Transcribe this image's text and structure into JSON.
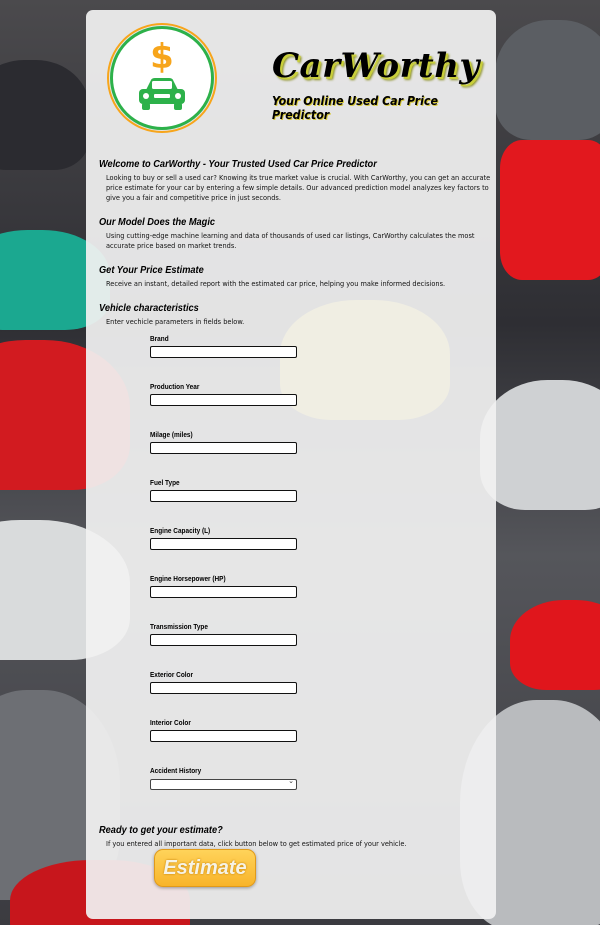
{
  "header": {
    "brand_title": "CarWorthy",
    "brand_subtitle": "Your Online Used Car Price Predictor"
  },
  "sections": {
    "welcome": {
      "heading": "Welcome to CarWorthy - Your Trusted Used Car Price Predictor",
      "text": "Looking to buy or sell a used car? Knowing its true market value is crucial. With CarWorthy, you can get an accurate price estimate for your car by entering a few simple details. Our advanced prediction model analyzes key factors to give you a fair and competitive price in just seconds."
    },
    "model": {
      "heading": "Our Model Does the Magic",
      "text": "Using cutting-edge machine learning and data of thousands of used car listings, CarWorthy calculates the most accurate price based on market trends."
    },
    "estimate": {
      "heading": "Get Your Price Estimate",
      "text": "Receive an instant, detailed report with the estimated car price, helping you make informed decisions."
    },
    "vehicle": {
      "heading": "Vehicle characteristics",
      "text": "Enter vechicle parameters in fields below."
    },
    "ready": {
      "heading": "Ready to get your estimate?",
      "text": "If you entered all important data, click button below to get estimated price of your vehicle."
    }
  },
  "form": {
    "fields": [
      {
        "label": "Brand",
        "value": ""
      },
      {
        "label": "Production Year",
        "value": ""
      },
      {
        "label": "Milage (miles)",
        "value": ""
      },
      {
        "label": "Fuel Type",
        "value": ""
      },
      {
        "label": "Engine Capacity (L)",
        "value": ""
      },
      {
        "label": "Engine Horsepower (HP)",
        "value": ""
      },
      {
        "label": "Transmission Type",
        "value": ""
      },
      {
        "label": "Exterior Color",
        "value": ""
      },
      {
        "label": "Interior Color",
        "value": ""
      }
    ],
    "select": {
      "label": "Accident History",
      "value": ""
    },
    "submit_label": "Estimate"
  },
  "icons": {
    "logo": "dollar-car-logo-icon",
    "select_chevron": "chevron-down-icon"
  },
  "colors": {
    "panel_bg": "#f1f1f1",
    "logo_green": "#2db14a",
    "logo_orange": "#f7a51b",
    "button_orange": "#f8b42a"
  }
}
